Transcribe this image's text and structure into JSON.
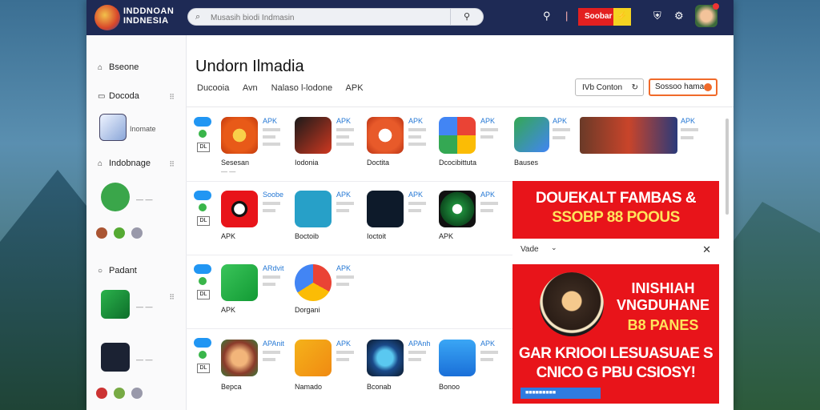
{
  "topbar": {
    "brand_line1": "INDDNOAN",
    "brand_line2": "INDNESIA",
    "search_placeholder": "Musasih biodi Indmasin",
    "red_button_label": "Soobar",
    "icons": [
      "search-icon",
      "notification-icon",
      "shield-icon",
      "settings-icon",
      "user-avatar"
    ]
  },
  "sidebar": {
    "sections": [
      "Bseone",
      "Docoda",
      "Indobnage",
      "Padant"
    ],
    "caption": "Inomate"
  },
  "main": {
    "title": "Undorn Ilmadia",
    "tabs": [
      "Ducooia",
      "Avn",
      "Nalaso l-lodone",
      "APK"
    ],
    "sort_label": "IVb Conton",
    "orange_label": "Sossoo hama"
  },
  "apps_rows": [
    [
      {
        "apk": "APK",
        "name": "Sesesan"
      },
      {
        "apk": "APK",
        "name": "Iodonia"
      },
      {
        "apk": "APK",
        "name": "Doctita"
      },
      {
        "apk": "APK",
        "name": "Dcocibittuta"
      },
      {
        "apk": "APK",
        "name": "Bauses"
      },
      {
        "apk": "APK",
        "name": ""
      }
    ],
    [
      {
        "apk": "Soobe",
        "name": "APK"
      },
      {
        "apk": "APK",
        "name": "Boctoib"
      },
      {
        "apk": "APK",
        "name": "Ioctoit"
      },
      {
        "apk": "APK",
        "name": "APK"
      }
    ],
    [
      {
        "apk": "ARdvit",
        "name": "APK"
      },
      {
        "apk": "APK",
        "name": "Dorgani"
      }
    ],
    [
      {
        "apk": "APAnit",
        "name": "Bepca"
      },
      {
        "apk": "APK",
        "name": "Namado"
      },
      {
        "apk": "APAnh",
        "name": "Bconab"
      },
      {
        "apk": "APK",
        "name": "Bonoo"
      }
    ]
  ],
  "ads": {
    "banner1_line1": "DOUEKALT FAMBAS &",
    "banner1_line2": "SSOBP 88 POOUS",
    "bar_label": "Vade",
    "banner2_title": "INISHIAH VNGDUHANE",
    "banner2_sub": "B8 PANES",
    "banner2_body": "GAR KRIOOI LESUASUAE S CNICO G PBU CSIOSY!"
  },
  "colors": {
    "topbar": "#1e2a55",
    "ad_red": "#e8141a",
    "accent_orange": "#f06a2a",
    "link_blue": "#2578d4"
  }
}
